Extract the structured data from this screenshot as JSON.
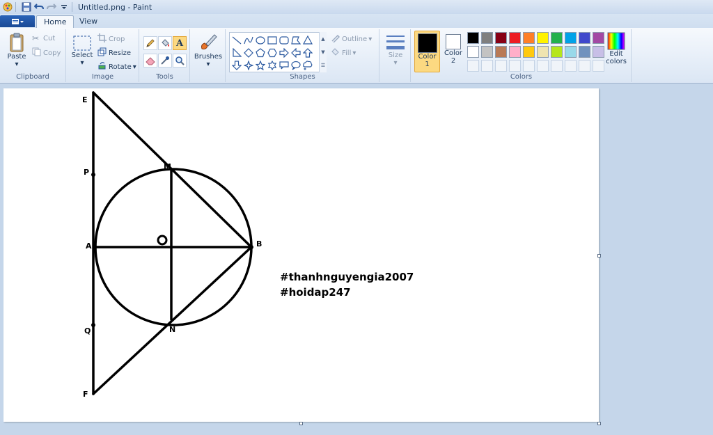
{
  "window": {
    "title": "Untitled.png - Paint"
  },
  "tabs": [
    {
      "label": "Home"
    },
    {
      "label": "View"
    }
  ],
  "clipboard": {
    "group_label": "Clipboard",
    "paste": "Paste",
    "cut": "Cut",
    "copy": "Copy"
  },
  "image": {
    "group_label": "Image",
    "select": "Select",
    "crop": "Crop",
    "resize": "Resize",
    "rotate": "Rotate"
  },
  "tools": {
    "group_label": "Tools",
    "items": [
      "pencil-icon",
      "fill-bucket-icon",
      "text-icon",
      "eraser-icon",
      "color-picker-icon",
      "magnifier-icon"
    ]
  },
  "brushes": {
    "label": "Brushes"
  },
  "shapes": {
    "group_label": "Shapes",
    "outline": "Outline",
    "fill": "Fill"
  },
  "size": {
    "label": "Size"
  },
  "colors": {
    "group_label": "Colors",
    "color1_label": "Color",
    "color1_num": "1",
    "color1_value": "#000000",
    "color2_label": "Color",
    "color2_num": "2",
    "color2_value": "#ffffff",
    "edit_colors": "Edit",
    "edit_colors_2": "colors",
    "palette_row1": [
      "#000000",
      "#7f7f7f",
      "#880015",
      "#ed1c24",
      "#ff7f27",
      "#fff200",
      "#22b14c",
      "#00a2e8",
      "#3f48cc",
      "#a349a4"
    ],
    "palette_row2": [
      "#ffffff",
      "#c3c3c3",
      "#b97a57",
      "#ffaec9",
      "#ffc90e",
      "#efe4b0",
      "#b5e61d",
      "#99d9ea",
      "#7092be",
      "#c8bfe7"
    ],
    "palette_row3": [
      "#f0f4f9",
      "#f0f4f9",
      "#f0f4f9",
      "#f0f4f9",
      "#f0f4f9",
      "#f0f4f9",
      "#f0f4f9",
      "#f0f4f9",
      "#f0f4f9",
      "#f0f4f9"
    ]
  },
  "drawing": {
    "labels": {
      "E": "E",
      "P": "P",
      "M": "M",
      "A": "A",
      "O": "O",
      "B": "B",
      "Q": "Q",
      "N": "N",
      "F": "F"
    },
    "text_line1": "#thanhnguyengia2007",
    "text_line2": "#hoidap247"
  }
}
